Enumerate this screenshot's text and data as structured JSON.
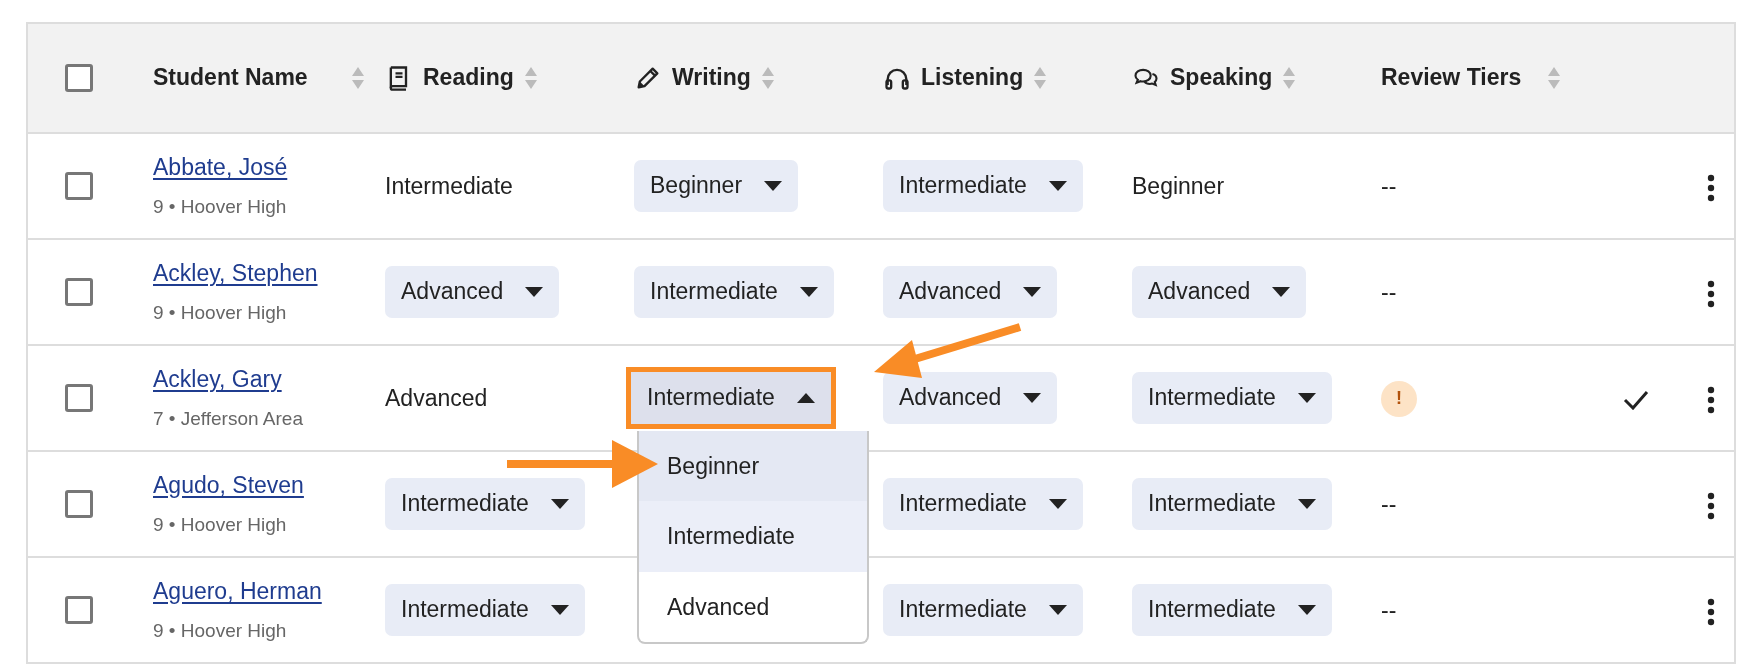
{
  "header": {
    "select_all": {
      "checked": false
    },
    "columns": [
      {
        "label": "Student Name",
        "sortable": true
      },
      {
        "label": "Reading",
        "sortable": true
      },
      {
        "label": "Writing",
        "sortable": true
      },
      {
        "label": "Listening",
        "sortable": true
      },
      {
        "label": "Speaking",
        "sortable": true
      },
      {
        "label": "Review Tiers",
        "sortable": true
      }
    ]
  },
  "rows": [
    {
      "checked": false,
      "name": "Abbate, José",
      "detail": "9 • Hoover High",
      "cells": {
        "reading": {
          "kind": "text",
          "value": "Intermediate"
        },
        "writing": {
          "kind": "select",
          "value": "Beginner",
          "expanded": false
        },
        "listening": {
          "kind": "select",
          "value": "Intermediate",
          "expanded": false
        },
        "speaking": {
          "kind": "text",
          "value": "Beginner"
        },
        "review": {
          "kind": "text",
          "value": "--"
        }
      }
    },
    {
      "checked": false,
      "name": "Ackley, Stephen",
      "detail": "9 • Hoover High",
      "cells": {
        "reading": {
          "kind": "select",
          "value": "Advanced",
          "expanded": false
        },
        "writing": {
          "kind": "select",
          "value": "Intermediate",
          "expanded": false
        },
        "listening": {
          "kind": "select",
          "value": "Advanced",
          "expanded": false
        },
        "speaking": {
          "kind": "select",
          "value": "Advanced",
          "expanded": false
        },
        "review": {
          "kind": "text",
          "value": "--"
        }
      }
    },
    {
      "checked": false,
      "name": "Ackley, Gary",
      "detail": "7 • Jefferson Area",
      "reviewed": true,
      "cells": {
        "reading": {
          "kind": "text",
          "value": "Advanced"
        },
        "writing": {
          "kind": "select",
          "value": "Intermediate",
          "expanded": true,
          "highlighted": true,
          "options": [
            {
              "label": "Beginner",
              "hovered": true,
              "selected": false
            },
            {
              "label": "Intermediate",
              "hovered": false,
              "selected": true
            },
            {
              "label": "Advanced",
              "hovered": false,
              "selected": false
            }
          ]
        },
        "listening": {
          "kind": "select",
          "value": "Advanced",
          "expanded": false
        },
        "speaking": {
          "kind": "select",
          "value": "Intermediate",
          "expanded": false
        },
        "review": {
          "kind": "alert",
          "value": "!"
        }
      }
    },
    {
      "checked": false,
      "name": "Agudo, Steven",
      "detail": "9 • Hoover High",
      "cells": {
        "reading": {
          "kind": "select",
          "value": "Intermediate",
          "expanded": false
        },
        "listening": {
          "kind": "select",
          "value": "Intermediate",
          "expanded": false
        },
        "speaking": {
          "kind": "select",
          "value": "Intermediate",
          "expanded": false
        },
        "review": {
          "kind": "text",
          "value": "--"
        }
      }
    },
    {
      "checked": false,
      "name": "Aguero, Herman",
      "detail": "9 • Hoover High",
      "cells": {
        "reading": {
          "kind": "select",
          "value": "Intermediate",
          "expanded": false
        },
        "listening": {
          "kind": "select",
          "value": "Intermediate",
          "expanded": false
        },
        "speaking": {
          "kind": "select",
          "value": "Intermediate",
          "expanded": false
        },
        "review": {
          "kind": "text",
          "value": "--"
        }
      }
    }
  ]
}
